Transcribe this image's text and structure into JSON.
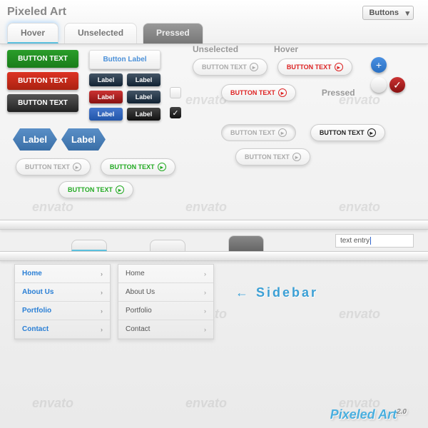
{
  "header": {
    "title": "Pixeled Art",
    "dropdown": "Buttons",
    "tabs": [
      "Hover",
      "Unselected",
      "Pressed"
    ]
  },
  "columns": {
    "unselected": "Unselected",
    "hover": "Hover",
    "pressed": "Pressed"
  },
  "buttons": {
    "text": "BUTTON TEXT",
    "label": "Button Label",
    "small_label": "Label",
    "hex_label": "Label"
  },
  "text_entry": "text entry",
  "sidebar": {
    "title": "Sidebar",
    "items": [
      "Home",
      "About Us",
      "Portfolio",
      "Contact"
    ]
  },
  "logo": {
    "name": "Pixeled Art",
    "version": "2.0"
  },
  "watermark": "envato",
  "icons": {
    "plus": "+",
    "check": "✓",
    "arrow": "▸",
    "left_arrow": "←",
    "chevron": "›"
  }
}
